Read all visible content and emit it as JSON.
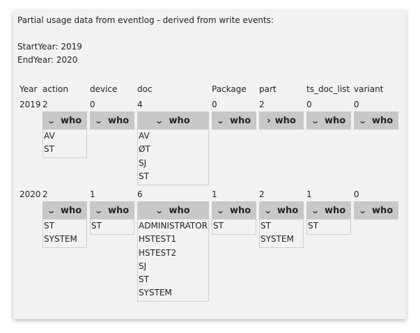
{
  "intro": "Partial usage data from eventlog - derived from write events:",
  "start_year_label": "StartYear: 2019",
  "end_year_label": "EndYear: 2020",
  "headers": [
    "Year",
    "action",
    "device",
    "doc",
    "Package",
    "part",
    "ts_doc_list",
    "variant"
  ],
  "button_label": "who",
  "chevron_collapsed": "⌄",
  "chevron_expanded": "›",
  "rows": [
    {
      "year": "2019",
      "counts": [
        "2",
        "0",
        "4",
        "0",
        "2",
        "0",
        "0"
      ],
      "lists": [
        [
          "AV",
          "ST"
        ],
        [],
        [
          "AV",
          "ØT",
          "SJ",
          "ST"
        ],
        [],
        [],
        [],
        []
      ],
      "toggle_state": [
        "expanded",
        "collapsed",
        "expanded",
        "collapsed",
        "collapsed-right",
        "collapsed",
        "collapsed"
      ]
    },
    {
      "year": "2020",
      "counts": [
        "2",
        "1",
        "6",
        "1",
        "2",
        "1",
        "0"
      ],
      "lists": [
        [
          "ST",
          "SYSTEM"
        ],
        [
          "ST"
        ],
        [
          "ADMINISTRATOR",
          "HSTEST1",
          "HSTEST2",
          "SJ",
          "ST",
          "SYSTEM"
        ],
        [
          "ST"
        ],
        [
          "ST",
          "SYSTEM"
        ],
        [
          "ST"
        ],
        []
      ],
      "toggle_state": [
        "expanded",
        "expanded",
        "expanded",
        "expanded",
        "expanded",
        "expanded",
        "collapsed"
      ]
    }
  ]
}
